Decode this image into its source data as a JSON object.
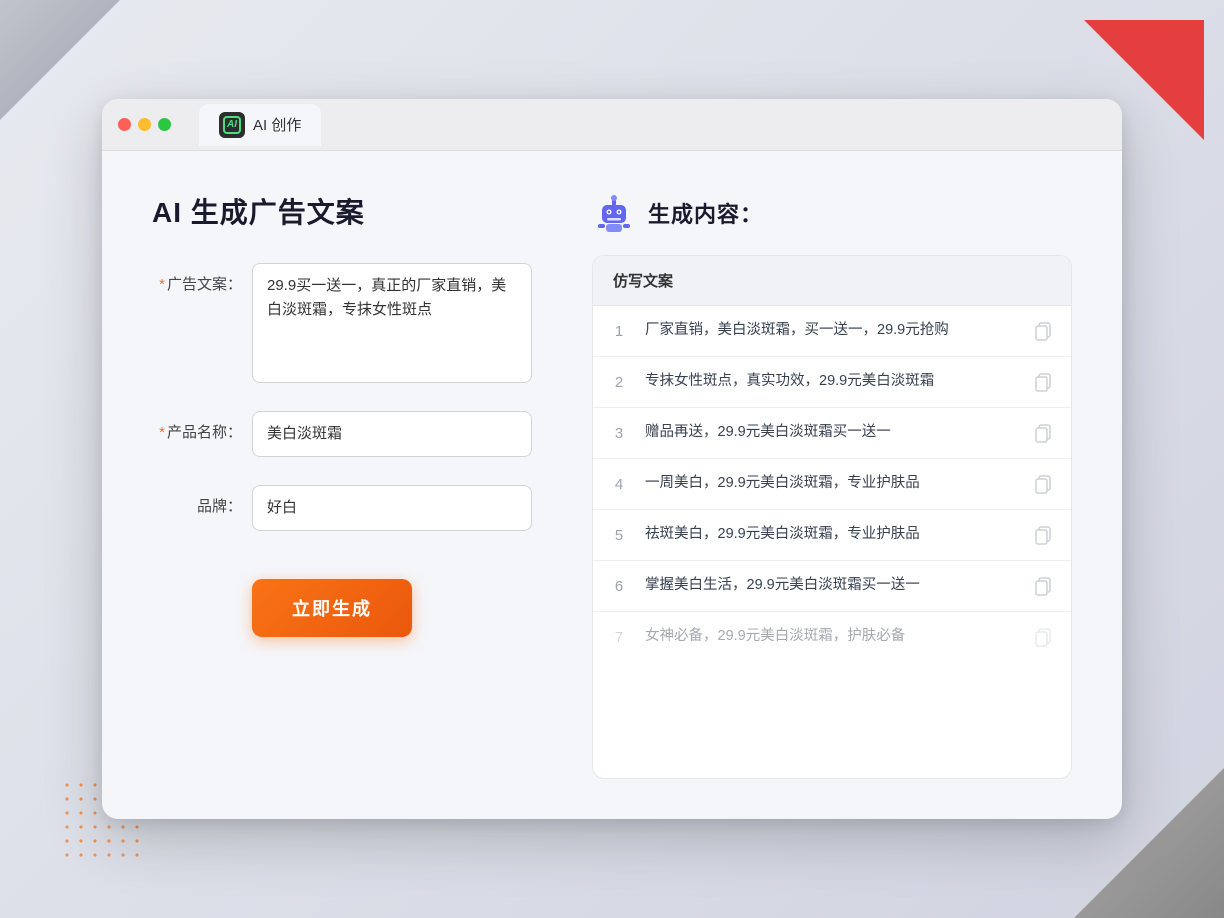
{
  "browser": {
    "tab_label": "AI 创作",
    "ai_icon_text": "AI"
  },
  "left_panel": {
    "title": "AI 生成广告文案",
    "ad_copy_label": "广告文案：",
    "ad_copy_required": "＊",
    "ad_copy_value": "29.9买一送一，真正的厂家直销，美白淡斑霜，专抹女性斑点",
    "product_name_label": "产品名称：",
    "product_name_required": "＊",
    "product_name_value": "美白淡斑霜",
    "brand_label": "品牌：",
    "brand_value": "好白",
    "generate_button": "立即生成"
  },
  "right_panel": {
    "result_title": "生成内容：",
    "table_header": "仿写文案",
    "rows": [
      {
        "num": "1",
        "text": "厂家直销，美白淡斑霜，买一送一，29.9元抢购",
        "dimmed": false
      },
      {
        "num": "2",
        "text": "专抹女性斑点，真实功效，29.9元美白淡斑霜",
        "dimmed": false
      },
      {
        "num": "3",
        "text": "赠品再送，29.9元美白淡斑霜买一送一",
        "dimmed": false
      },
      {
        "num": "4",
        "text": "一周美白，29.9元美白淡斑霜，专业护肤品",
        "dimmed": false
      },
      {
        "num": "5",
        "text": "祛斑美白，29.9元美白淡斑霜，专业护肤品",
        "dimmed": false
      },
      {
        "num": "6",
        "text": "掌握美白生活，29.9元美白淡斑霜买一送一",
        "dimmed": false
      },
      {
        "num": "7",
        "text": "女神必备，29.9元美白淡斑霜，护肤必备",
        "dimmed": true
      }
    ]
  }
}
